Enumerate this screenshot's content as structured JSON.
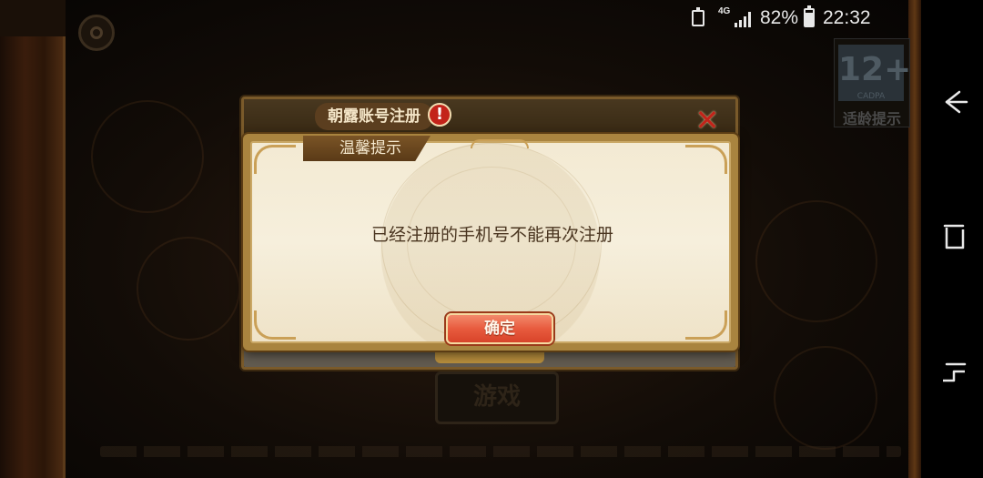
{
  "status_bar": {
    "network": "4G",
    "battery_percent": "82%",
    "battery_level": 0.82,
    "time": "22:32",
    "icons": [
      "battery-saver-icon",
      "signal-icon",
      "battery-icon"
    ]
  },
  "background": {
    "age_rating": "12+",
    "age_rating_sub": "CADPA",
    "age_rating_label": "适龄提示",
    "bottom_emblem": "游戏"
  },
  "register_panel": {
    "title": "朝露账号注册",
    "warning_symbol": "!",
    "close_symbol": "✕"
  },
  "dialog": {
    "title": "温馨提示",
    "message": "已经注册的手机号不能再次注册",
    "confirm_label": "确定"
  },
  "nav_bar": {
    "icons": [
      "back-icon",
      "recent-apps-icon",
      "home-icon"
    ]
  },
  "colors": {
    "dialog_frame": "#a9843f",
    "dialog_body": "#f6efdc",
    "button": "#e85b3e",
    "warning": "#c3231a",
    "title_tab": "#5a3a17"
  }
}
